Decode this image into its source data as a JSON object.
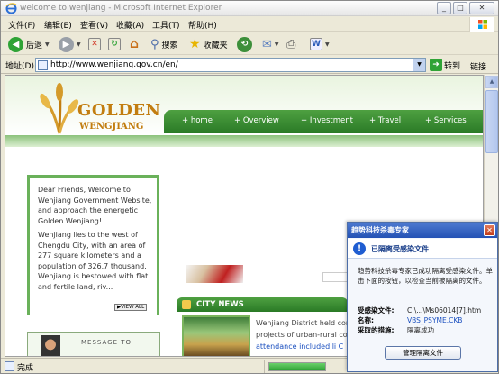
{
  "window": {
    "title": "welcome to wenjiang - Microsoft Internet Explorer",
    "controls": {
      "minimize": "_",
      "maximize": "□",
      "close": "✕"
    }
  },
  "menu": [
    "文件(F)",
    "编辑(E)",
    "查看(V)",
    "收藏(A)",
    "工具(T)",
    "帮助(H)"
  ],
  "toolbar": {
    "back_label": "后退",
    "search_label": "搜索",
    "favorites_label": "收藏夹",
    "back_glyph": "◀",
    "forward_glyph": "▶",
    "stop_glyph": "✕",
    "refresh_glyph": "↻",
    "home_glyph": "⌂",
    "search_glyph": "⚲",
    "favorites_glyph": "★",
    "history_glyph": "⟲",
    "mail_glyph": "✉",
    "print_glyph": "⎙",
    "edit_glyph": "W",
    "caret": "▼"
  },
  "address": {
    "label": "地址(D)",
    "url": "http://www.wenjiang.gov.cn/en/",
    "go_label": "转到",
    "go_glyph": "➜",
    "links_label": "链接"
  },
  "page": {
    "logo_top": "GOLDEN",
    "logo_bottom": "WENGJIANG",
    "nav": [
      "+ home",
      "+ Overview",
      "+ Investment",
      "+ Travel",
      "+ Services"
    ],
    "intro_p1": "Dear Friends, Welcome to Wenjiang Government Website, and approach the energetic Golden Wenjiang!",
    "intro_p2": "Wenjiang lies to the west of Chengdu City, with an area of 277 square kilometers and a population of 326.7 thousand. Wenjiang is bestowed with flat and fertile land, riv...",
    "view_all": "▶VIEW ALL",
    "city_news_title": "CITY NEWS",
    "news_line1": "Wenjiang District held con",
    "news_line2": "projects of urban-rural co",
    "news_line3": "attendance included li C",
    "message_label": "MESSAGE TO"
  },
  "popup": {
    "title": "趋势科技杀毒专家",
    "close_glyph": "✕",
    "heading": "已隔离受感染文件",
    "warn_glyph": "!",
    "message": "趋势科技杀毒专家已成功隔离受感染文件。单击下面的按钮，以检查当前被隔离的文件。",
    "file_label": "受感染文件:",
    "file_value": "C:\\...\\Ms06014[7].htm",
    "name_label": "名称:",
    "name_value": "VBS_PSYME.CKB",
    "action_label": "采取的措施:",
    "action_value": "隔离成功",
    "button_label": "管理隔离文件"
  },
  "status": {
    "text": "完成",
    "progress": 1.0
  },
  "colors": {
    "nav_green": "#2a7a26",
    "logo_gold": "#c27d10",
    "popup_blue": "#2452b5"
  }
}
